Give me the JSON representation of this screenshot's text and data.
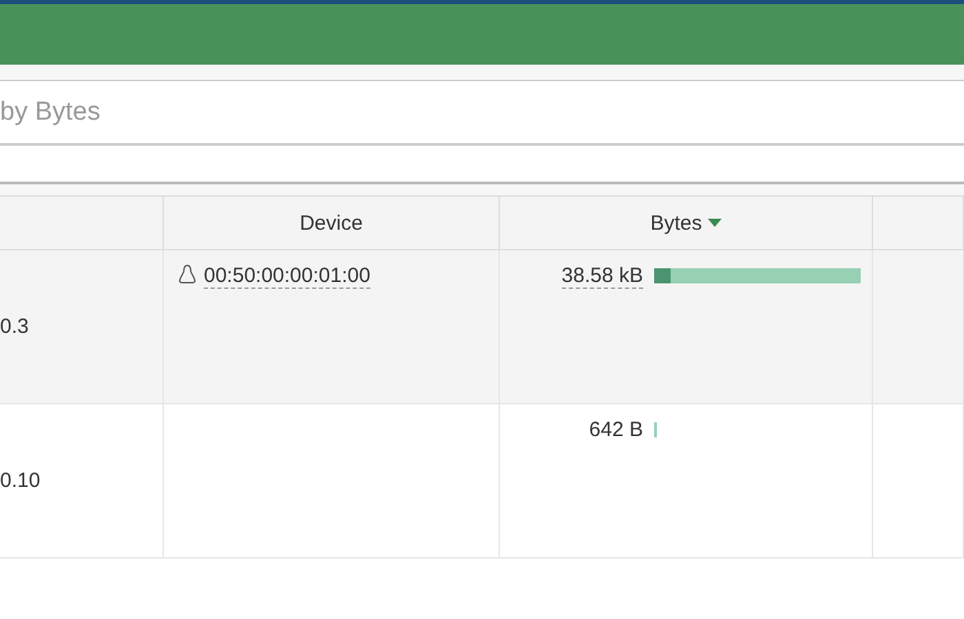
{
  "search": {
    "placeholder": "by Bytes"
  },
  "table": {
    "columns": [
      {},
      {
        "label": "Device"
      },
      {
        "label": "Bytes",
        "sorted": true
      },
      {}
    ],
    "rows": [
      {
        "ip": "0.3",
        "device": "00:50:00:00:01:00",
        "bytes": "38.58 kB",
        "bytes_underlined": true,
        "kind": "wide",
        "segments": [
          {
            "kind": "sent"
          },
          {
            "kind": "received"
          }
        ]
      },
      {
        "ip": "0.10",
        "bytes": "642 B",
        "bytes_underlined": false,
        "kind": "sliver",
        "segments": [
          {
            "kind": "received"
          }
        ]
      }
    ]
  }
}
